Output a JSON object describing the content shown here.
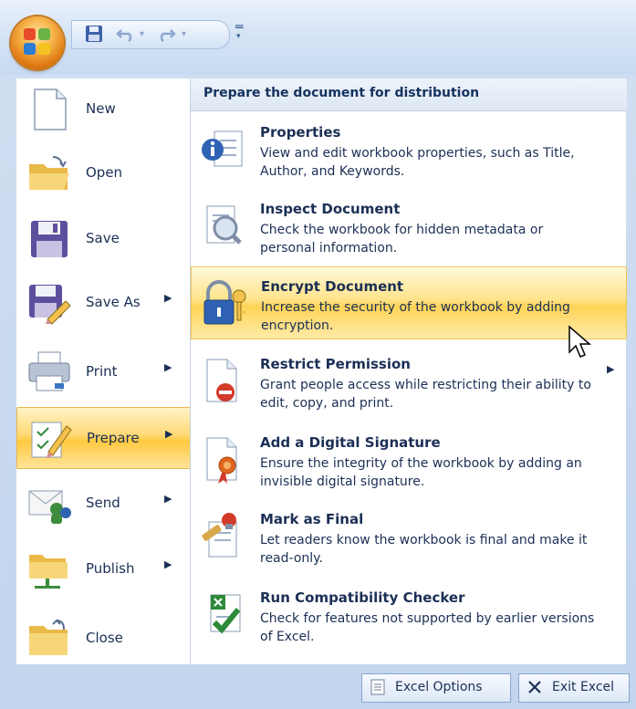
{
  "qat": {
    "save_icon": "save-icon",
    "undo_icon": "undo-icon",
    "redo_icon": "redo-icon"
  },
  "left_menu": {
    "items": [
      {
        "label": "New",
        "icon": "new-document-icon",
        "has_submenu": false
      },
      {
        "label": "Open",
        "icon": "open-folder-icon",
        "has_submenu": false
      },
      {
        "label": "Save",
        "icon": "save-disk-icon",
        "has_submenu": false
      },
      {
        "label": "Save As",
        "icon": "save-as-icon",
        "has_submenu": true
      },
      {
        "label": "Print",
        "icon": "printer-icon",
        "has_submenu": true
      },
      {
        "label": "Prepare",
        "icon": "prepare-pen-icon",
        "has_submenu": true
      },
      {
        "label": "Send",
        "icon": "send-icon",
        "has_submenu": true
      },
      {
        "label": "Publish",
        "icon": "publish-icon",
        "has_submenu": true
      },
      {
        "label": "Close",
        "icon": "close-folder-icon",
        "has_submenu": false
      }
    ],
    "active_index": 5
  },
  "submenu": {
    "header": "Prepare the document for distribution",
    "items": [
      {
        "title": "Properties",
        "desc": "View and edit workbook properties, such as Title, Author, and Keywords.",
        "icon": "properties-icon"
      },
      {
        "title": "Inspect Document",
        "desc": "Check the workbook for hidden metadata or personal information.",
        "icon": "inspect-document-icon"
      },
      {
        "title": "Encrypt Document",
        "desc": "Increase the security of the workbook by adding encryption.",
        "icon": "encrypt-lock-icon"
      },
      {
        "title": "Restrict Permission",
        "desc": "Grant people access while restricting their ability to edit, copy, and print.",
        "icon": "restrict-permission-icon"
      },
      {
        "title": "Add a Digital Signature",
        "desc": "Ensure the integrity of the workbook by adding an invisible digital signature.",
        "icon": "digital-signature-icon"
      },
      {
        "title": "Mark as Final",
        "desc": "Let readers know the workbook is final and make it read-only.",
        "icon": "mark-final-icon"
      },
      {
        "title": "Run Compatibility Checker",
        "desc": "Check for features not supported by earlier versions of Excel.",
        "icon": "compatibility-checker-icon"
      }
    ],
    "active_index": 2
  },
  "footer": {
    "options_label": "Excel Options",
    "exit_label": "Exit Excel"
  },
  "colors": {
    "frame": "#c7daf1",
    "highlight": "#ffd457",
    "text": "#1b2f55"
  }
}
